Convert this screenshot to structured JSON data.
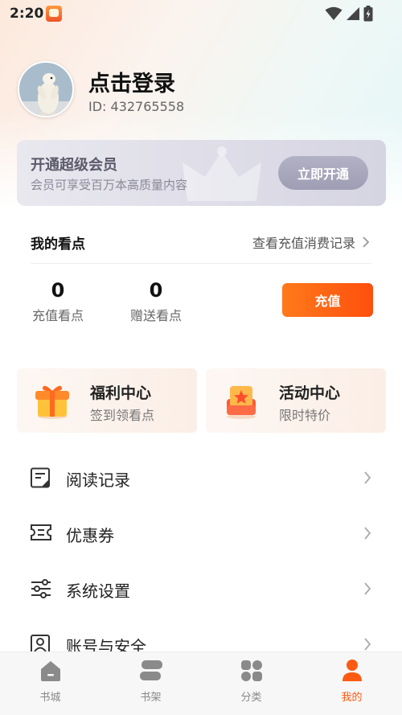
{
  "status_bar": {
    "time": "2:20"
  },
  "profile": {
    "name": "点击登录",
    "user_id": "ID: 432765558"
  },
  "vip": {
    "title": "开通超级会员",
    "subtitle": "会员可享受百万本高质量内容",
    "button_label": "立即开通"
  },
  "points": {
    "title": "我的看点",
    "history_link": "查看充值消费记录",
    "recharged_value": "0",
    "recharged_label": "充值看点",
    "gifted_value": "0",
    "gifted_label": "赠送看点",
    "recharge_button": "充值"
  },
  "features": [
    {
      "title": "福利中心",
      "subtitle": "签到领看点",
      "icon": "gift-icon"
    },
    {
      "title": "活动中心",
      "subtitle": "限时特价",
      "icon": "star-box-icon"
    }
  ],
  "menu": [
    {
      "label": "阅读记录",
      "icon": "reading-history-icon"
    },
    {
      "label": "优惠券",
      "icon": "coupon-icon"
    },
    {
      "label": "系统设置",
      "icon": "settings-sliders-icon"
    },
    {
      "label": "账号与安全",
      "icon": "account-security-icon"
    }
  ],
  "tabs": [
    {
      "label": "书城",
      "icon": "home-icon",
      "active": false
    },
    {
      "label": "书架",
      "icon": "bookshelf-icon",
      "active": false
    },
    {
      "label": "分类",
      "icon": "category-grid-icon",
      "active": false
    },
    {
      "label": "我的",
      "icon": "profile-icon",
      "active": true
    }
  ],
  "colors": {
    "accent": "#ff5a12",
    "recharge_gradient_start": "#ff7a1a",
    "vip_button": "#a9a7bc",
    "tab_inactive": "#888888"
  }
}
